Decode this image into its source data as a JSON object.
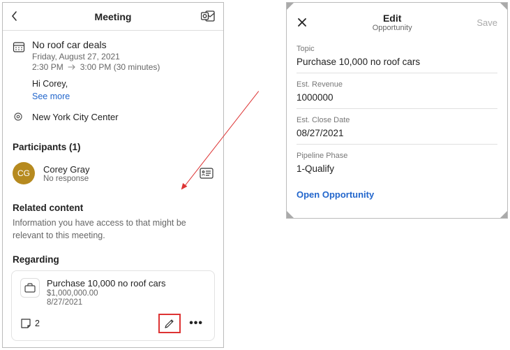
{
  "left": {
    "header_title": "Meeting",
    "event_title": "No roof car deals",
    "date_line": "Friday, August 27, 2021",
    "time_start": "2:30 PM",
    "time_end": "3:00 PM (30 minutes)",
    "greeting": "Hi Corey,",
    "see_more": "See more",
    "location": "New York City Center",
    "participants_header": "Participants (1)",
    "participant": {
      "initials": "CG",
      "name": "Corey Gray",
      "response": "No response"
    },
    "related_header": "Related content",
    "related_sub": "Information you have access to that might be relevant to this meeting.",
    "regarding_header": "Regarding",
    "card": {
      "title": "Purchase 10,000 no roof cars",
      "amount": "$1,000,000.00",
      "date": "8/27/2021",
      "notes_count": "2"
    }
  },
  "right": {
    "title": "Edit",
    "subtitle": "Opportunity",
    "save": "Save",
    "fields": {
      "topic_label": "Topic",
      "topic_value": "Purchase 10,000 no roof cars",
      "rev_label": "Est. Revenue",
      "rev_value": "1000000",
      "close_label": "Est. Close Date",
      "close_value": "08/27/2021",
      "phase_label": "Pipeline Phase",
      "phase_value": "1-Qualify"
    },
    "open_link": "Open Opportunity"
  }
}
